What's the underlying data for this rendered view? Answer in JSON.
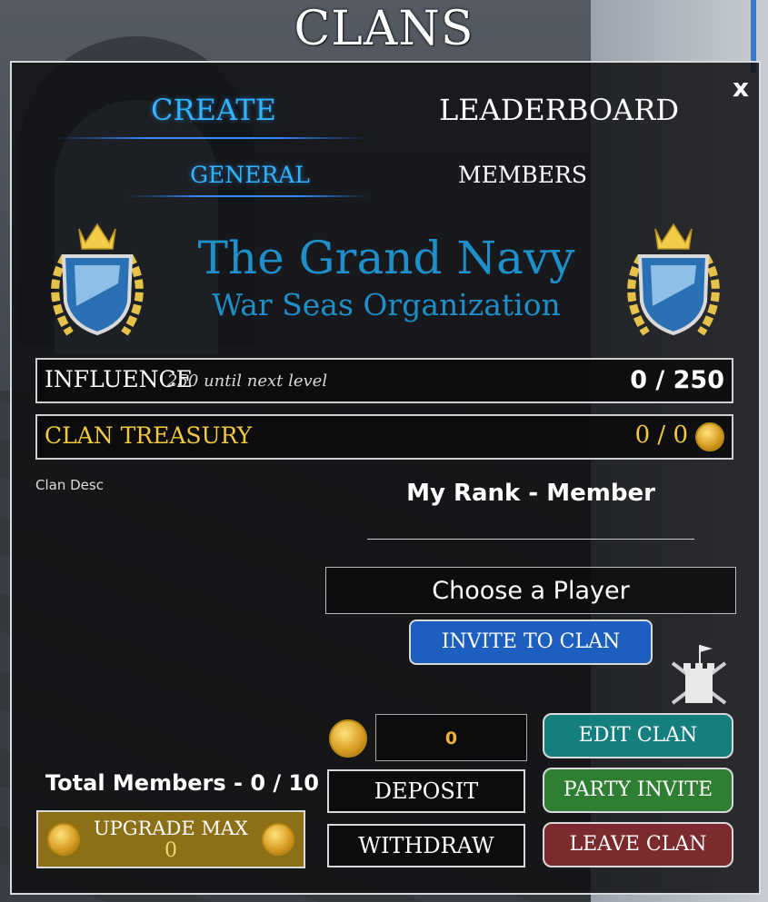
{
  "window": {
    "title": "CLANS",
    "close_label": "x"
  },
  "tabs": {
    "main": [
      {
        "label": "CREATE"
      },
      {
        "label": "LEADERBOARD"
      }
    ],
    "sub": [
      {
        "label": "GENERAL"
      },
      {
        "label": "MEMBERS"
      }
    ]
  },
  "clan": {
    "name": "The Grand Navy",
    "subtitle": "War Seas Organization",
    "description": "Clan Desc"
  },
  "influence": {
    "label": "INFLUENCE",
    "note": "250 until next level",
    "value": "0 / 250"
  },
  "treasury": {
    "label": "CLAN TREASURY",
    "value": "0 / 0"
  },
  "rank": {
    "text": "My Rank - Member"
  },
  "invite": {
    "player_placeholder": "Choose a Player",
    "button_label": "INVITE TO CLAN"
  },
  "bank": {
    "amount": "0",
    "deposit_label": "DEPOSIT",
    "withdraw_label": "WITHDRAW"
  },
  "actions": {
    "edit_label": "EDIT CLAN",
    "party_label": "PARTY INVITE",
    "leave_label": "LEAVE CLAN"
  },
  "members": {
    "total_text": "Total Members - 0 / 10",
    "upgrade_label": "UPGRADE MAX",
    "upgrade_cost": "0"
  },
  "colors": {
    "active_tab": "#33b4ff",
    "clan_name": "#1f8fc9",
    "treasury": "#f2c93f",
    "invite_button": "#1d5fbf",
    "edit_button": "#157f80",
    "party_button": "#2e7f32",
    "leave_button": "#7b2a2d",
    "upgrade_button": "#8c6f16"
  },
  "icons": {
    "emblem": "shield-crown-laurel-icon",
    "war": "castle-swords-icon",
    "coin": "gold-coin-icon"
  }
}
